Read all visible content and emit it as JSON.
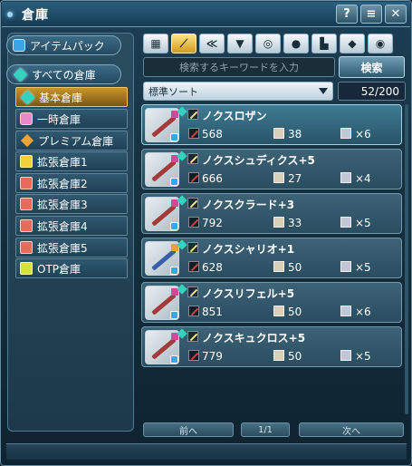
{
  "window": {
    "title": "倉庫",
    "buttons": [
      "?",
      "≡",
      "✕"
    ]
  },
  "sidebar": {
    "top_item": "アイテムパック",
    "group_label": "すべての倉庫",
    "items": [
      {
        "label": "基本倉庫",
        "active": true,
        "icon": "teal-diamond-icon"
      },
      {
        "label": "一時倉庫",
        "active": false,
        "icon": "pink-box-icon"
      },
      {
        "label": "プレミアム倉庫",
        "active": false,
        "icon": "orange-diamond-icon"
      },
      {
        "label": "拡張倉庫1",
        "active": false,
        "icon": "yellow-box-icon"
      },
      {
        "label": "拡張倉庫2",
        "active": false,
        "icon": "red-box-icon"
      },
      {
        "label": "拡張倉庫3",
        "active": false,
        "icon": "red-box-icon"
      },
      {
        "label": "拡張倉庫4",
        "active": false,
        "icon": "red-box-icon"
      },
      {
        "label": "拡張倉庫5",
        "active": false,
        "icon": "red-box-icon"
      },
      {
        "label": "OTP倉庫",
        "active": false,
        "icon": "yellow-box-icon"
      }
    ]
  },
  "tabs": [
    "grid-icon",
    "sword-icon",
    "twin-blade-icon",
    "shirt-icon",
    "ring-icon",
    "disc-icon",
    "chair-icon",
    "diamond-icon",
    "bag-icon"
  ],
  "search": {
    "placeholder": "検索するキーワードを入力",
    "button": "検索"
  },
  "sort": {
    "label": "標準ソート",
    "count": "52/200"
  },
  "items": [
    {
      "name": "ノクスロザン",
      "atk": "568",
      "slots": "38",
      "stack": "×6"
    },
    {
      "name": "ノクスシュディクス+5",
      "atk": "666",
      "slots": "27",
      "stack": "×4"
    },
    {
      "name": "ノクスクラード+3",
      "atk": "792",
      "slots": "33",
      "stack": "×5"
    },
    {
      "name": "ノクスシャリオ+1",
      "atk": "628",
      "slots": "50",
      "stack": "×5"
    },
    {
      "name": "ノクスリフェル+5",
      "atk": "851",
      "slots": "50",
      "stack": "×6"
    },
    {
      "name": "ノクスキュクロス+5",
      "atk": "779",
      "slots": "50",
      "stack": "×5"
    }
  ],
  "pager": {
    "prev": "前へ",
    "page": "1/1",
    "next": "次へ"
  }
}
